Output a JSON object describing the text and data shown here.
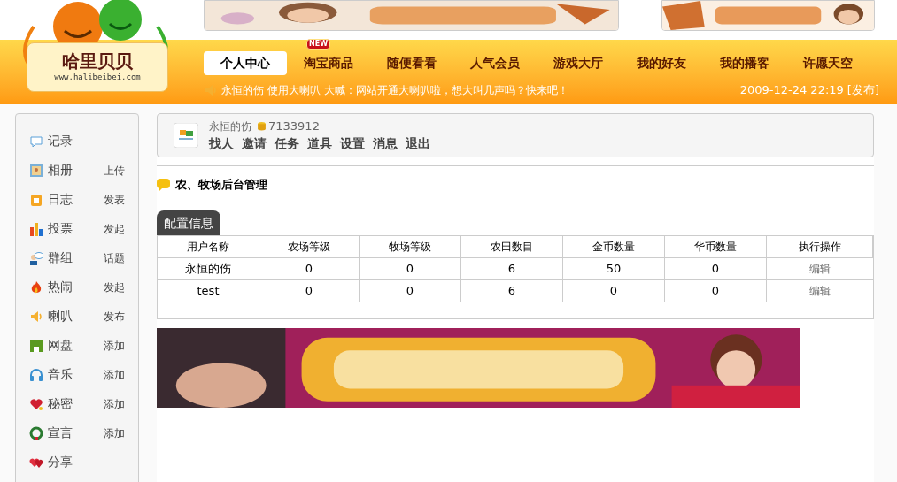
{
  "logo": {
    "name": "哈里贝贝",
    "url": "www.halibeibei.com"
  },
  "nav": [
    {
      "label": "个人中心",
      "selected": true
    },
    {
      "label": "淘宝商品",
      "selected": false,
      "badge": "NEW"
    },
    {
      "label": "随便看看",
      "selected": false
    },
    {
      "label": "人气会员",
      "selected": false
    },
    {
      "label": "游戏大厅",
      "selected": false
    },
    {
      "label": "我的好友",
      "selected": false
    },
    {
      "label": "我的播客",
      "selected": false
    },
    {
      "label": "许愿天空",
      "selected": false
    }
  ],
  "broadcast": {
    "user": "永恒的伤",
    "text": "使用大喇叭 大喊：网站开通大喇叭啦，想大叫几声吗？快来吧！",
    "time": "2009-12-24 22:19",
    "action": "[发布]"
  },
  "sidebar": [
    {
      "label": "记录"
    },
    {
      "label": "相册",
      "action": "上传"
    },
    {
      "label": "日志",
      "action": "发表"
    },
    {
      "label": "投票",
      "action": "发起"
    },
    {
      "label": "群组",
      "action": "话题"
    },
    {
      "label": "热闹",
      "action": "发起"
    },
    {
      "label": "喇叭",
      "action": "发布"
    },
    {
      "label": "网盘",
      "action": "添加"
    },
    {
      "label": "音乐",
      "action": "添加"
    },
    {
      "label": "秘密",
      "action": "添加"
    },
    {
      "label": "宣言",
      "action": "添加"
    },
    {
      "label": "分享"
    }
  ],
  "user": {
    "name": "永恒的伤",
    "coins": "7133912",
    "links": [
      "找人",
      "邀请",
      "任务",
      "道具",
      "设置",
      "消息",
      "退出"
    ]
  },
  "section_title": "农、牧场后台管理",
  "tab": "配置信息",
  "table": {
    "columns": [
      "用户名称",
      "农场等级",
      "牧场等级",
      "农田数目",
      "金币数量",
      "华币数量",
      "执行操作"
    ],
    "rows": [
      [
        "永恒的伤",
        "0",
        "0",
        "6",
        "50",
        "0",
        "编辑"
      ],
      [
        "test",
        "0",
        "0",
        "6",
        "0",
        "0",
        "编辑"
      ]
    ]
  }
}
